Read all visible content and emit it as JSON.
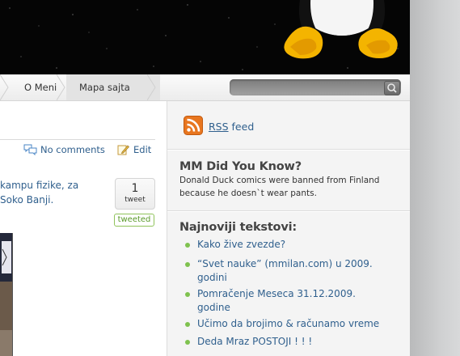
{
  "nav": {
    "items": [
      {
        "label": "O Meni"
      },
      {
        "label": "Mapa sajta"
      }
    ],
    "search": {
      "placeholder": "",
      "value": ""
    }
  },
  "post": {
    "comments_label": "No comments",
    "edit_label": "Edit",
    "text_line1": "kampu fizike, za",
    "text_line2": "Soko Banji.",
    "tweet": {
      "count": "1",
      "word": "tweet",
      "status": "tweeted"
    }
  },
  "sidebar": {
    "rss": {
      "label_abbr": "RSS",
      "label_rest": " feed"
    },
    "did_you_know": {
      "title": "MM Did You Know?",
      "line1": "Donald Duck comics were banned from Finland",
      "line2": "because he doesn`t wear pants."
    },
    "latest": {
      "title": "Najnoviji tekstovi:",
      "items": [
        {
          "line1": "Kako žive zvezde?",
          "line2": ""
        },
        {
          "line1": "“Svet nauke” (mmilan.com) u 2009.",
          "line2": "godini"
        },
        {
          "line1": "Pomračenje Meseca 31.12.2009.",
          "line2": "godine"
        },
        {
          "line1": "Učimo da brojimo & računamo vreme",
          "line2": ""
        },
        {
          "line1": "Deda Mraz POSTOJI ! ! !",
          "line2": ""
        }
      ]
    }
  },
  "colors": {
    "link": "#2f5f8d",
    "bullet": "#7fc24f",
    "header": "#050505",
    "rss": "#e8761f"
  }
}
